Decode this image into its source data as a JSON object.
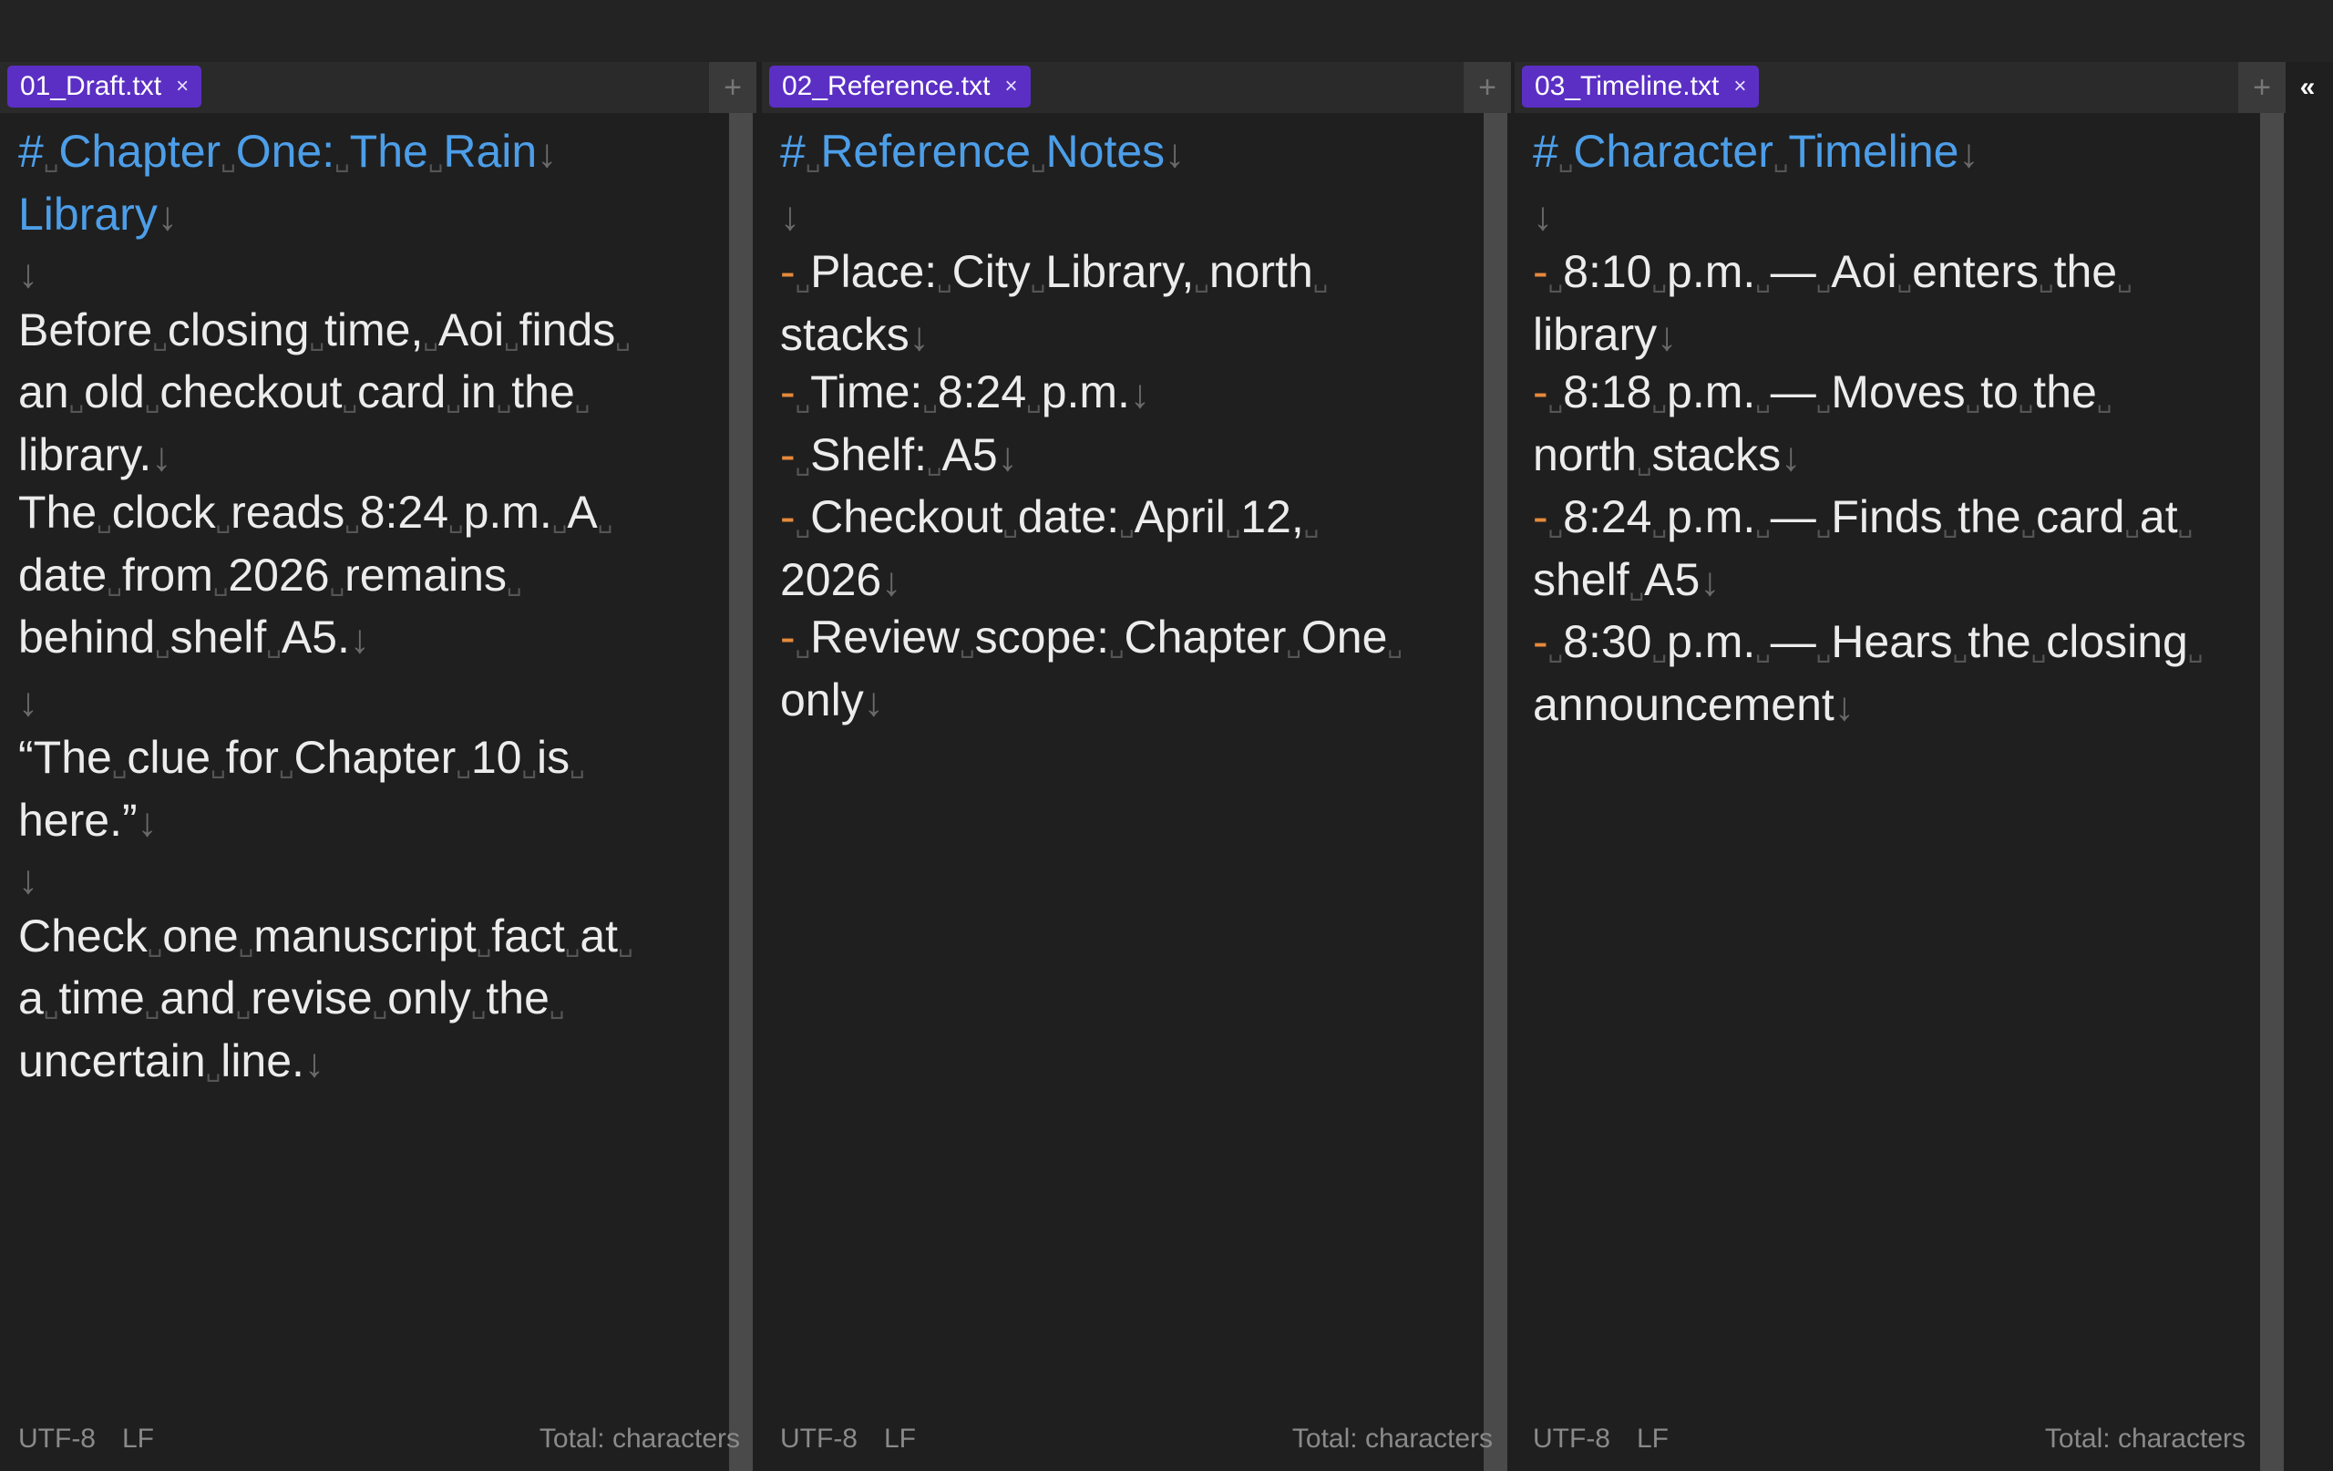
{
  "panes": [
    {
      "tab_label": "01_Draft.txt",
      "close_icon": "×",
      "lines": [
        {
          "type": "heading",
          "marker": "#",
          "text": "Chapter One: The Rain"
        },
        {
          "type": "heading-cont",
          "text": "Library"
        },
        {
          "type": "blank"
        },
        {
          "type": "wrap",
          "text": "Before closing time, Aoi finds"
        },
        {
          "type": "wrap",
          "text": "an old checkout card in the"
        },
        {
          "type": "text",
          "text": "library."
        },
        {
          "type": "wrap",
          "text": "The clock reads 8:24 p.m. A"
        },
        {
          "type": "wrap",
          "text": "date from 2026 remains"
        },
        {
          "type": "text",
          "text": "behind shelf A5."
        },
        {
          "type": "blank"
        },
        {
          "type": "wrap",
          "text": "“The clue for Chapter 10 is"
        },
        {
          "type": "text",
          "text": "here.”"
        },
        {
          "type": "blank"
        },
        {
          "type": "wrap",
          "text": "Check one manuscript fact at"
        },
        {
          "type": "wrap",
          "text": "a time and revise only the"
        },
        {
          "type": "text",
          "text": "uncertain line."
        }
      ],
      "status": {
        "encoding": "UTF-8",
        "eol": "LF",
        "total": "Total:  characters"
      }
    },
    {
      "tab_label": "02_Reference.txt",
      "close_icon": "×",
      "lines": [
        {
          "type": "heading",
          "marker": "#",
          "text": "Reference Notes"
        },
        {
          "type": "blank"
        },
        {
          "type": "bullet-wrap",
          "marker": "-",
          "text": "Place: City Library, north"
        },
        {
          "type": "text",
          "text": "stacks"
        },
        {
          "type": "bullet",
          "marker": "-",
          "text": "Time: 8:24 p.m."
        },
        {
          "type": "bullet",
          "marker": "-",
          "text": "Shelf: A5"
        },
        {
          "type": "bullet-wrap",
          "marker": "-",
          "text": "Checkout date: April 12,"
        },
        {
          "type": "text",
          "text": "2026"
        },
        {
          "type": "bullet-wrap",
          "marker": "-",
          "text": "Review scope: Chapter One"
        },
        {
          "type": "text",
          "text": "only"
        }
      ],
      "status": {
        "encoding": "UTF-8",
        "eol": "LF",
        "total": "Total:  characters"
      }
    },
    {
      "tab_label": "03_Timeline.txt",
      "close_icon": "×",
      "lines": [
        {
          "type": "heading",
          "marker": "#",
          "text": "Character Timeline"
        },
        {
          "type": "blank"
        },
        {
          "type": "bullet-wrap",
          "marker": "-",
          "text": "8:10 p.m. — Aoi enters the"
        },
        {
          "type": "text",
          "text": "library"
        },
        {
          "type": "bullet-wrap",
          "marker": "-",
          "text": "8:18 p.m. — Moves to the"
        },
        {
          "type": "text",
          "text": "north stacks"
        },
        {
          "type": "bullet-wrap",
          "marker": "-",
          "text": "8:24 p.m. — Finds the card at"
        },
        {
          "type": "text",
          "text": "shelf A5"
        },
        {
          "type": "bullet-wrap",
          "marker": "-",
          "text": "8:30 p.m. — Hears the closing"
        },
        {
          "type": "text",
          "text": "announcement"
        }
      ],
      "status": {
        "encoding": "UTF-8",
        "eol": "LF",
        "total": "Total:  characters"
      }
    }
  ],
  "symbols": {
    "plus": "+",
    "newline": "↓",
    "space_mark": "␣",
    "collapse": "«"
  },
  "colors": {
    "tab": "#5b2fc4",
    "heading": "#4d9ee8",
    "bullet": "#e68a3c"
  }
}
